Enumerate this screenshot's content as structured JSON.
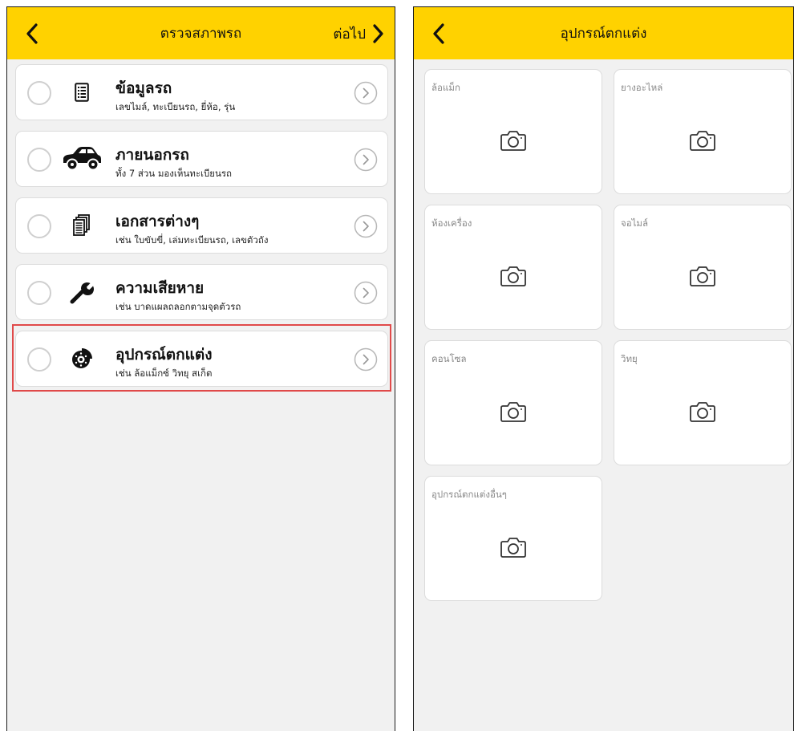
{
  "left_screen": {
    "header": {
      "title": "ตรวจสภาพรถ",
      "next_label": "ต่อไป"
    },
    "items": [
      {
        "title": "ข้อมูลรถ",
        "subtitle": "เลขไมล์, ทะเบียนรถ, ยี่ห้อ, รุ่น",
        "icon": "document-list-icon"
      },
      {
        "title": "ภายนอกรถ",
        "subtitle": "ทั้ง 7 ส่วน มองเห็นทะเบียนรถ",
        "icon": "car-icon"
      },
      {
        "title": "เอกสารต่างๆ",
        "subtitle": "เช่น ใบขับขี่, เล่มทะเบียนรถ, เลขตัวถัง",
        "icon": "documents-icon"
      },
      {
        "title": "ความเสียหาย",
        "subtitle": "เช่น บาดแผลถลอกตามจุดตัวรถ",
        "icon": "wrench-icon"
      },
      {
        "title": "อุปกรณ์ตกแต่ง",
        "subtitle": "เช่น ล้อแม็กซ์ วิทยุ สเก็ต",
        "icon": "brake-disc-icon",
        "selected": true
      }
    ]
  },
  "right_screen": {
    "header": {
      "title": "อุปกรณ์ตกแต่ง"
    },
    "cards": [
      {
        "label": "ล้อแม็ก"
      },
      {
        "label": "ยางอะไหล่"
      },
      {
        "label": "ห้องเครื่อง"
      },
      {
        "label": "จอไมล์"
      },
      {
        "label": "คอนโซล"
      },
      {
        "label": "วิทยุ"
      },
      {
        "label": "อุปกรณ์ตกแต่งอื่นๆ"
      }
    ]
  },
  "colors": {
    "header_bg": "#ffd200",
    "page_bg": "#f1f1f1",
    "highlight": "#e04a4a"
  }
}
